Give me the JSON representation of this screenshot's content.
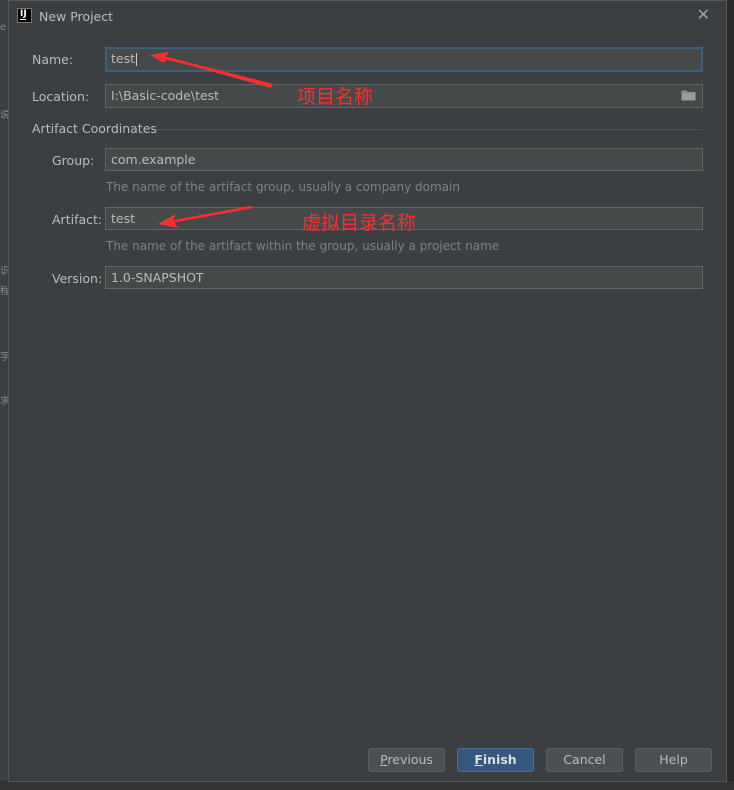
{
  "dialog": {
    "title": "New Project",
    "close_glyph": "✕"
  },
  "form": {
    "name": {
      "label": "Name:",
      "value": "test"
    },
    "location": {
      "label": "Location:",
      "value": "I:\\Basic-code\\test"
    },
    "section_title": "Artifact Coordinates",
    "group": {
      "label": "Group:",
      "value": "com.example",
      "hint": "The name of the artifact group, usually a company domain"
    },
    "artifact": {
      "label": "Artifact:",
      "value": "test",
      "hint": "The name of the artifact within the group, usually a project name"
    },
    "version": {
      "label": "Version:",
      "value": "1.0-SNAPSHOT"
    }
  },
  "annotations": {
    "project_name": "项目名称",
    "virtual_dir_name": "虚拟目录名称",
    "color": "#ff2d2d"
  },
  "buttons": {
    "previous": {
      "mnemonic": "P",
      "rest": "revious"
    },
    "finish": {
      "mnemonic": "F",
      "rest": "inish"
    },
    "cancel": "Cancel",
    "help": "Help"
  },
  "colors": {
    "dialog_bg": "#3c3f41",
    "field_bg": "#45494a",
    "focus_border": "#3d6185",
    "primary_button": "#365880"
  },
  "background_glyphs": [
    "e",
    "说",
    "识",
    "程",
    "字",
    "求"
  ]
}
